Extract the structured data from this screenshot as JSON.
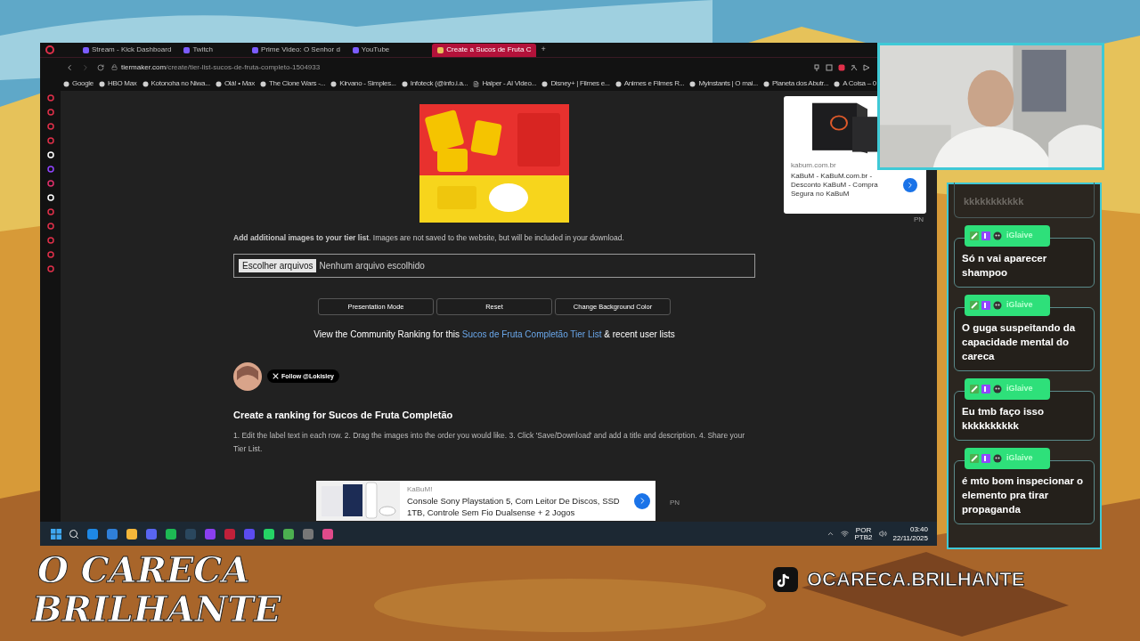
{
  "browser": {
    "tabs": [
      {
        "label": "Stream - Kick Dashboard",
        "selected": false
      },
      {
        "label": "Twitch",
        "selected": false
      },
      {
        "label": "Prime Video: O Senhor d",
        "selected": false
      },
      {
        "label": "YouTube",
        "selected": false
      },
      {
        "label": "Create a Sucos de Fruta C",
        "selected": true
      }
    ],
    "new_tab": "+",
    "url": {
      "domain": "tiermaker.com",
      "path": "/create/tier-list-sucos-de-fruta-completo-1504933"
    },
    "bookmarks": [
      "Google",
      "HBO Max",
      "Kotonoha no Niwa...",
      "Olá! • Max",
      "The Clone Wars -...",
      "Kirvano - Simples...",
      "Infoteck (@info.i.a...",
      "Halper - AI Video...",
      "Disney+ | Filmes e...",
      "Animes e Filmes R...",
      "Myinstants | O mai...",
      "Planeta dos Abutr...",
      "A Coisa – 0"
    ],
    "page": {
      "add_images_text": "**Add additional images to your tier list**. Images are not saved to the website, but will be included in your download.",
      "file_input": {
        "button": "Escolher arquivos",
        "status": "Nenhum arquivo escolhido"
      },
      "buttons": [
        "Presentation Mode",
        "Reset",
        "Change Background Color"
      ],
      "community": {
        "before": "View the Community Ranking for this ",
        "link": "Sucos de Fruta Completão Tier List",
        "after": " & recent user lists"
      },
      "follow": "Follow @Lokisley",
      "heading": "Create a ranking for Sucos de Fruta Completão",
      "instructions": "1. Edit the label text in each row. 2. Drag the images into the order you would like. 3. Click 'Save/Download' and add a title and description. 4. Share your Tier List.",
      "side_ad": {
        "domain": "kabum.com.br",
        "text": "KaBuM - KaBuM.com.br - Desconto KaBuM - Compra Segura no KaBuM",
        "tag": "PN"
      },
      "bottom_ad": {
        "brand": "KaBuM!",
        "text": "Console Sony Playstation 5, Com Leitor De Discos, SSD 1TB, Controle Sem Fio Dualsense + 2 Jogos",
        "tag": "PN"
      }
    }
  },
  "taskbar": {
    "language": "POR",
    "layout": "PTB2",
    "time": "03:40",
    "date": "22/11/2025"
  },
  "chat": {
    "partial_message": "kkkkkkkkkkk",
    "messages": [
      {
        "user": "iGlaive",
        "text": "Só n vai aparecer shampoo"
      },
      {
        "user": "iGlaive",
        "text": "O guga suspeitando da capacidade mental do careca"
      },
      {
        "user": "iGlaive",
        "text": "Eu tmb faço isso kkkkkkkkkk"
      },
      {
        "user": "iGlaive",
        "text": "é mto bom inspecionar o elemento pra tirar propaganda"
      }
    ]
  },
  "brand": {
    "lines": [
      "O CARECA",
      "BRILHANTE"
    ]
  },
  "social": {
    "handle": "OCARECA.BRILHANTE"
  }
}
